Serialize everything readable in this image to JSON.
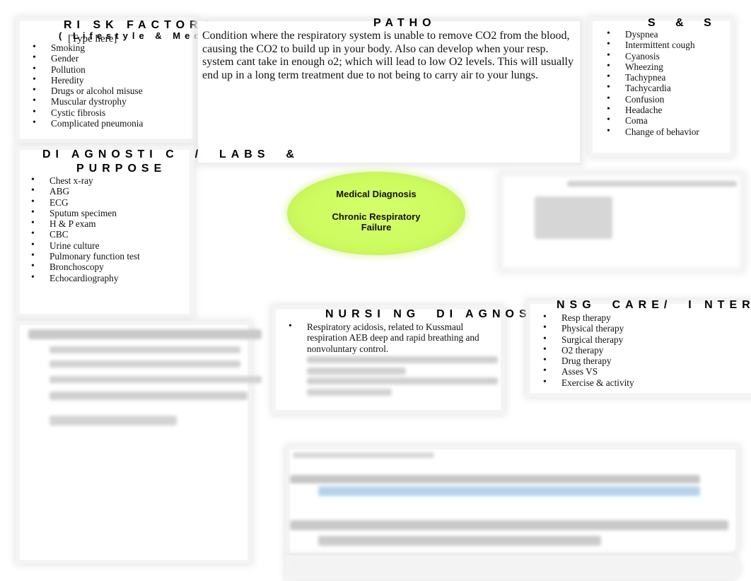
{
  "risk_factors": {
    "title": "RI SK  FACTORS",
    "subtitle": "( Lifestyle & Medical Condition)",
    "placeholder": "[Type here]",
    "items": [
      "Smoking",
      "Gender",
      "Pollution",
      "Heredity",
      "Drugs or alcohol misuse",
      "Muscular dystrophy",
      "Cystic fibrosis",
      "Complicated pneumonia"
    ]
  },
  "patho": {
    "title": "PATHO",
    "text": "Condition where the respiratory system is unable to remove CO2 from the blood, causing the CO2 to build up in your body. Also can develop when your resp. system cant take in enough o2; which will lead to low O2 levels. This will usually end up in a long term treatment due to not being to carry air to your lungs."
  },
  "signs_symptoms": {
    "title": "S & S",
    "items": [
      "Dyspnea",
      "Intermittent cough",
      "Cyanosis",
      "Wheezing",
      "Tachypnea",
      "Tachycardia",
      "Confusion",
      "Headache",
      "Coma",
      "Change of behavior"
    ]
  },
  "diagnostics": {
    "title_line1": "DI AGNOSTI C  /  LABS  &",
    "title_line2": "PURPOSE",
    "items": [
      "Chest x-ray",
      "ABG",
      "ECG",
      "Sputum specimen",
      "H & P exam",
      "CBC",
      "Urine culture",
      "Pulmonary function test",
      "Bronchoscopy",
      "Echocardiography"
    ]
  },
  "medical_diagnosis": {
    "label": "Medical Diagnosis",
    "diagnosis_line1": "Chronic Respiratory",
    "diagnosis_line2": "Failure",
    "color": "#cdfb5f"
  },
  "nursing_diagnoses": {
    "title": "NURSI NG  DI AGNOSES",
    "items": [
      "Respiratory acidosis, related to Kussmaul respiration AEB deep and rapid breathing and nonvoluntary control."
    ]
  },
  "nsg_care": {
    "title": "NSG  CARE/  I NTERVENTI",
    "items": [
      "Resp therapy",
      "Physical therapy",
      "Surgical therapy",
      "O2 therapy",
      "Drug therapy",
      "Asses VS",
      "Exercise & activity"
    ]
  },
  "colors": {
    "blurred_link_highlight": "#b7d3ec",
    "box_shadow": "#e8e8e8"
  }
}
